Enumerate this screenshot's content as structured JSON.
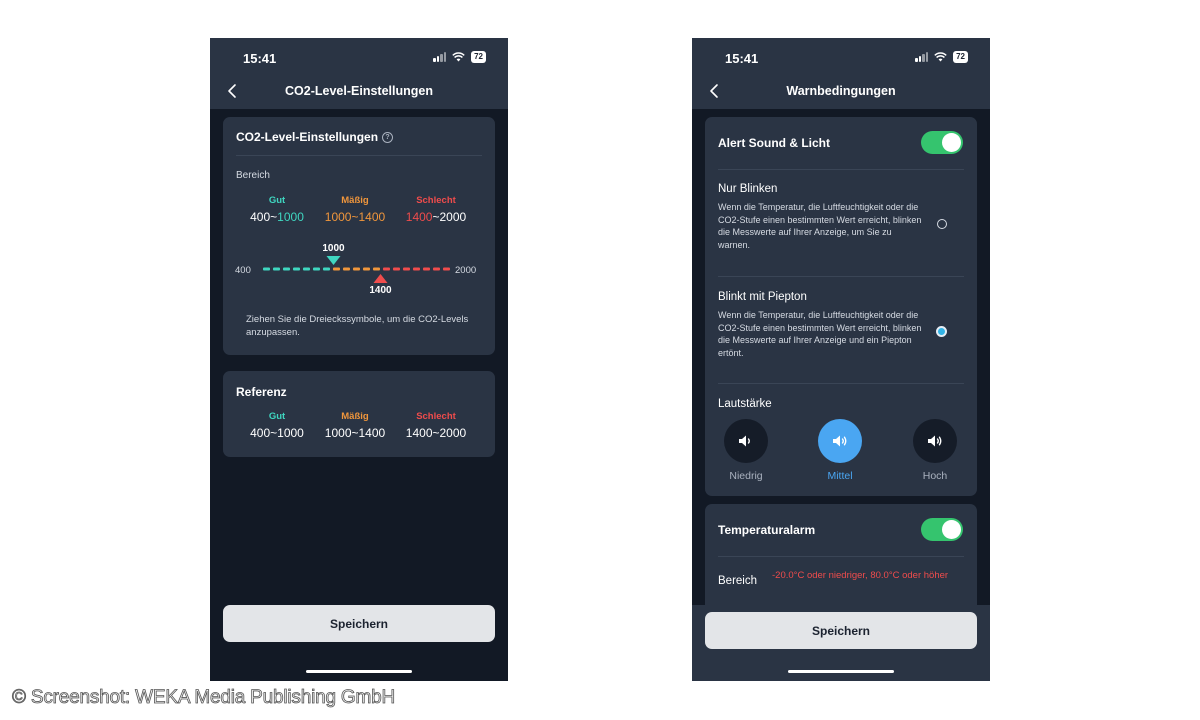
{
  "left": {
    "status_time": "15:41",
    "battery": "72",
    "nav_title": "CO2-Level-Einstellungen",
    "settings_card": {
      "title": "CO2-Level-Einstellungen",
      "help_icon": "?",
      "range_label": "Bereich",
      "gut": {
        "label": "Gut",
        "min": "400",
        "sep": "~",
        "max": "1000"
      },
      "maessig": {
        "label": "Mäßig",
        "min": "1000",
        "sep": "~",
        "max": "1400"
      },
      "schlecht": {
        "label": "Schlecht",
        "min": "1400",
        "sep": "~",
        "max": "2000"
      },
      "slider": {
        "min_label": "400",
        "max_label": "2000",
        "min": 400,
        "max": 2000,
        "lower": 1000,
        "upper": 1400,
        "lower_text": "1000",
        "upper_text": "1400"
      },
      "hint": "Ziehen Sie die Dreieckssymbole, um die CO2-Levels anzupassen."
    },
    "reference_card": {
      "title": "Referenz",
      "items": [
        {
          "label": "Gut",
          "value": "400~1000"
        },
        {
          "label": "Mäßig",
          "value": "1000~1400"
        },
        {
          "label": "Schlecht",
          "value": "1400~2000"
        }
      ]
    },
    "save_label": "Speichern"
  },
  "right": {
    "status_time": "15:41",
    "battery": "72",
    "nav_title": "Warnbedingungen",
    "alert": {
      "title": "Alert Sound & Licht",
      "enabled": true,
      "option1": {
        "title": "Nur Blinken",
        "desc": "Wenn die Temperatur, die Luftfeuchtigkeit oder die CO2-Stufe einen bestimmten Wert erreicht, blinken die Messwerte auf Ihrer Anzeige, um Sie zu warnen.",
        "selected": false
      },
      "option2": {
        "title": "Blinkt mit Piepton",
        "desc": "Wenn die Temperatur, die Luftfeuchtigkeit oder die CO2-Stufe einen bestimmten Wert erreicht, blinken die Messwerte auf Ihrer Anzeige und ein Piepton ertönt.",
        "selected": true
      },
      "volume_label": "Lautstärke",
      "volume": [
        {
          "label": "Niedrig",
          "icon": "speaker-low-icon",
          "active": false
        },
        {
          "label": "Mittel",
          "icon": "speaker-medium-icon",
          "active": true
        },
        {
          "label": "Hoch",
          "icon": "speaker-high-icon",
          "active": false
        }
      ]
    },
    "temperature_alarm": {
      "title": "Temperaturalarm",
      "enabled": true,
      "range_label": "Bereich",
      "range_value": "-20.0°C oder niedriger, 80.0°C oder höher"
    },
    "save_label": "Speichern"
  },
  "copyright": "© Screenshot: WEKA Media Publishing GmbH",
  "colors": {
    "good": "#3fd6c0",
    "moderate": "#f0963c",
    "bad": "#ef4c4c",
    "toggle_on": "#35c46e",
    "accent": "#4aa6f2"
  }
}
